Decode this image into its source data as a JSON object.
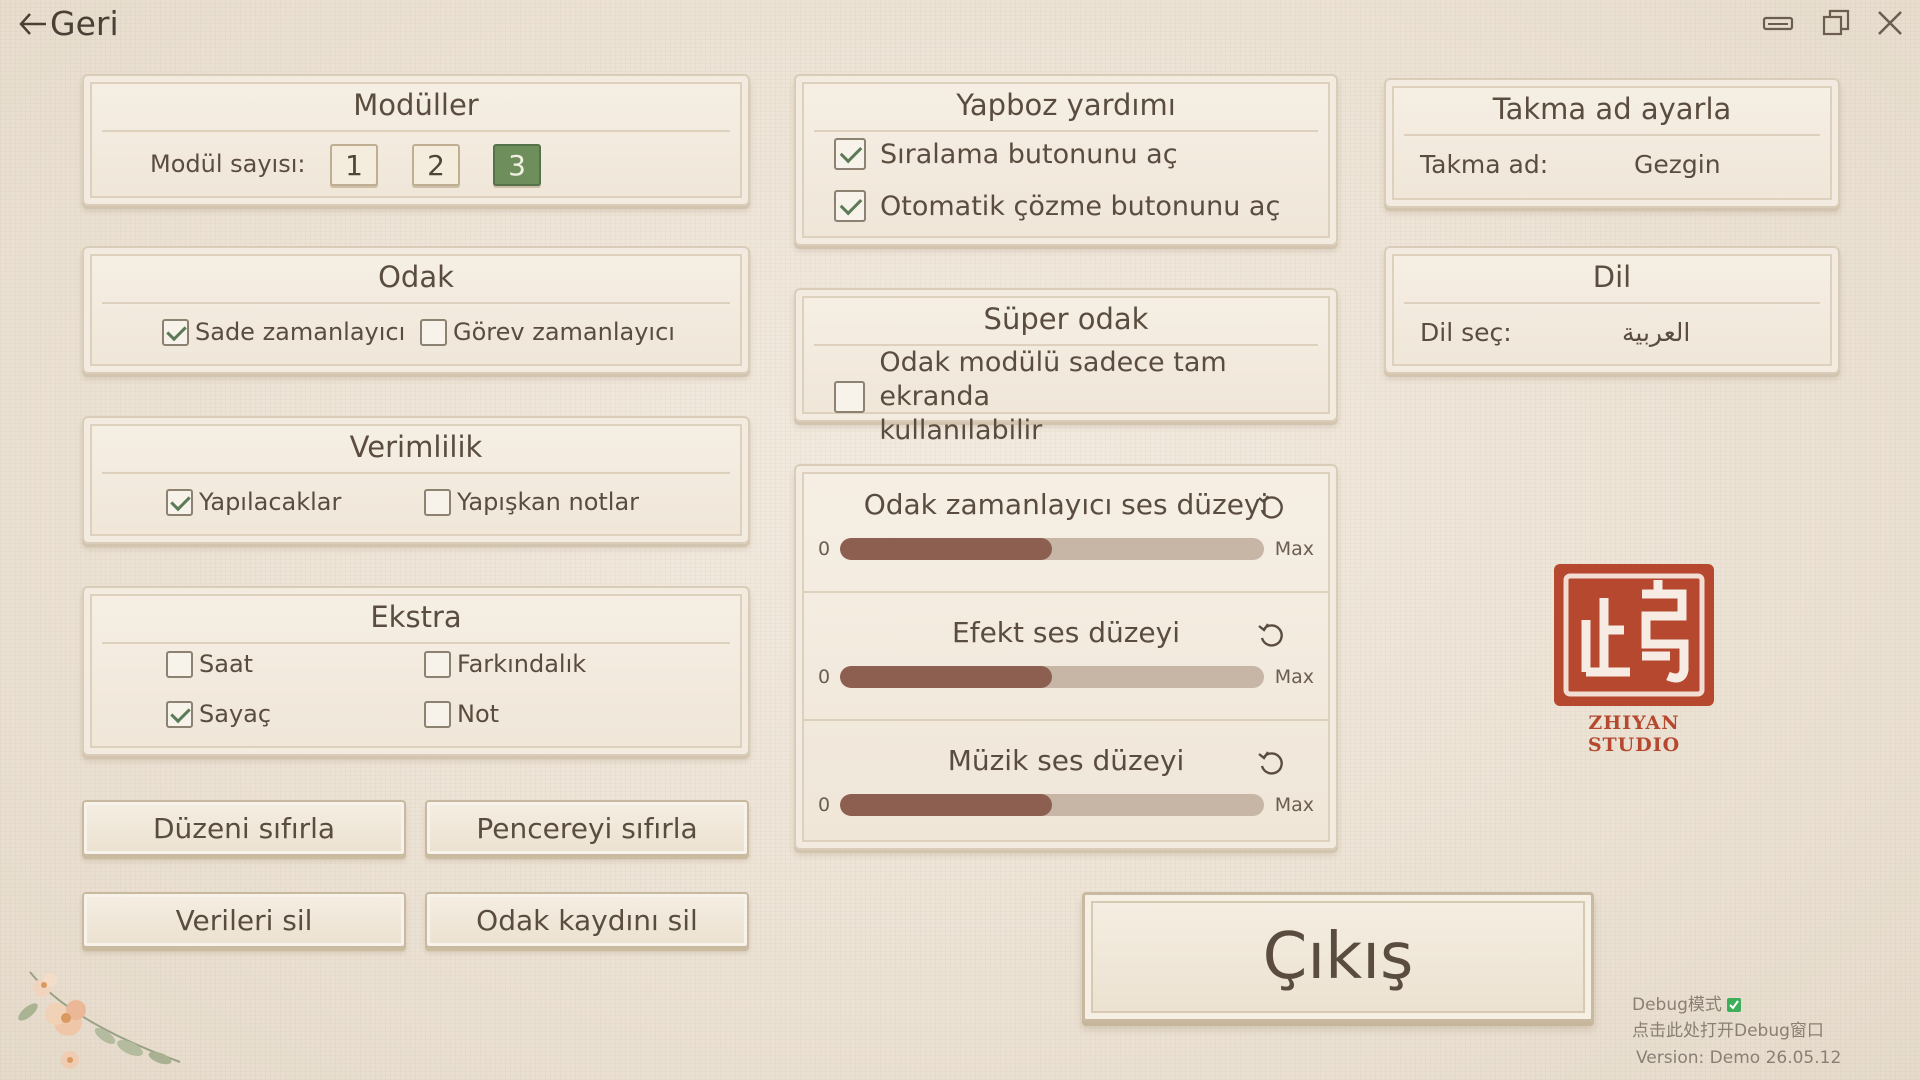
{
  "topbar": {
    "back_label": "Geri"
  },
  "modules": {
    "title": "Modüller",
    "count_label": "Modül sayısı:",
    "options": [
      "1",
      "2",
      "3"
    ],
    "selected": "3"
  },
  "focus": {
    "title": "Odak",
    "simple_timer": {
      "label": "Sade zamanlayıcı",
      "checked": true
    },
    "task_timer": {
      "label": "Görev zamanlayıcı",
      "checked": false
    }
  },
  "productivity": {
    "title": "Verimlilik",
    "todos": {
      "label": "Yapılacaklar",
      "checked": true
    },
    "sticky": {
      "label": "Yapışkan notlar",
      "checked": false
    }
  },
  "extra": {
    "title": "Ekstra",
    "clock": {
      "label": "Saat",
      "checked": false
    },
    "awareness": {
      "label": "Farkındalık",
      "checked": false
    },
    "counter": {
      "label": "Sayaç",
      "checked": true
    },
    "note": {
      "label": "Not",
      "checked": false
    }
  },
  "buttons": {
    "reset_layout": "Düzeni sıfırla",
    "reset_window": "Pencereyi sıfırla",
    "delete_data": "Verileri sil",
    "delete_focus_log": "Odak kaydını sil",
    "exit": "Çıkış"
  },
  "puzzle_help": {
    "title": "Yapboz yardımı",
    "sort_button": {
      "label": "Sıralama butonunu aç",
      "checked": true
    },
    "auto_solve": {
      "label": "Otomatik çözme butonunu aç",
      "checked": true
    }
  },
  "super_focus": {
    "title": "Süper odak",
    "fullscreen_only": {
      "label_line1": "Odak modülü sadece tam ekranda",
      "label_line2": "kullanılabilir",
      "checked": false
    }
  },
  "volume": {
    "min_label": "0",
    "max_label": "Max",
    "sliders": [
      {
        "label": "Odak zamanlayıcı ses düzeyi",
        "value": 0.5
      },
      {
        "label": "Efekt ses düzeyi",
        "value": 0.5
      },
      {
        "label": "Müzik ses düzeyi",
        "value": 0.5
      }
    ]
  },
  "nickname": {
    "title": "Takma ad ayarla",
    "label": "Takma ad:",
    "value": "Gezgin"
  },
  "language": {
    "title": "Dil",
    "label": "Dil seç:",
    "value": "العربية"
  },
  "logo": {
    "text": "ZHIYAN STUDIO",
    "color": "#b5482f"
  },
  "debug": {
    "mode_label": "Debug模式",
    "open_window_label": "点击此处打开Debug窗口",
    "version_label": "Version:",
    "version_value": "Demo 26.05.12"
  },
  "colors": {
    "accent_green": "#6e8f5b",
    "slider_fill": "#8d5f50",
    "slider_track": "#c7b6a5"
  }
}
